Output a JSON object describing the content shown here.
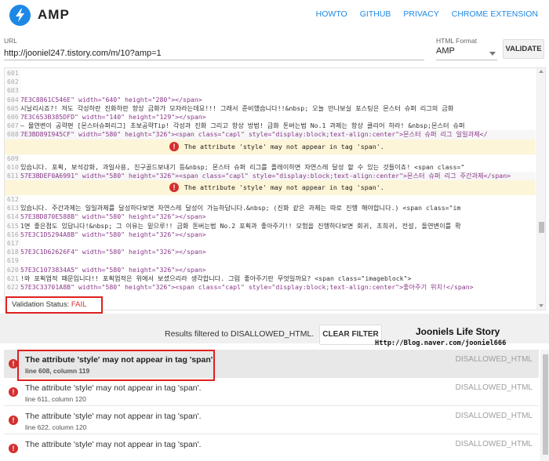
{
  "header": {
    "brand": "AMP",
    "nav": [
      "HOWTO",
      "GITHUB",
      "PRIVACY",
      "CHROME EXTENSION"
    ]
  },
  "url_field": {
    "label": "URL",
    "value": "http://jooniel247.tistory.com/m/10?amp=1"
  },
  "format_select": {
    "label": "HTML Format",
    "value": "AMP"
  },
  "validate_label": "VALIDATE",
  "editor": {
    "lines": [
      {
        "num": "601",
        "code": ""
      },
      {
        "num": "602",
        "code": ""
      },
      {
        "num": "603",
        "code": ""
      },
      {
        "num": "604",
        "code": "7E3C8861C546E\" width=\"640\" height=\"280\"></span>"
      },
      {
        "num": "605",
        "code": "시닐리시죠?! 저도 각성하란 진화하란 항상 금화가 모자라는데요!!! 그래서 준비했습니다!!&nbsp; 오늘 만나보실 포스팅은 몬스터 슈퍼 리그의 금화"
      },
      {
        "num": "606",
        "code": "7E3C653B385DFD\" width=\"140\" height=\"129\"></span>"
      },
      {
        "num": "607",
        "code": "– 몰연변이 공략편 [몬스터슈퍼리그] 초보공략Tip! 각성과 진화 그리고 항상 방법! 금화 돈버는법 No.1 과제는 항상 클리어 하라! &nbsp;몬스터 슈퍼"
      },
      {
        "num": "608",
        "code": "7E3BD89I945CF\" width=\"580\" height=\"326\"><span class=\"capl\" style=\"display:block;text-align:center\">몬스터 슈퍼 리그 일일과제</"
      }
    ],
    "error1": "The attribute 'style' may not appear in tag 'span'.",
    "lines2": [
      {
        "num": "609",
        "code": ""
      },
      {
        "num": "610",
        "code": "있습니다. 포획, 보석강화, 과일사용, 친구골드보내기 등&nbsp; 몬스터 슈퍼 리그를 플레이하면 자연스레 달성 할 수 있는 것들이죠! <span class=\""
      },
      {
        "num": "611",
        "code": "57E3BDEF0A6991\" width=\"580\" height=\"326\"><span class=\"capl\" style=\"display:block;text-align:center\">몬스터 슈퍼 리그 주간과제</span>"
      }
    ],
    "error2": "The attribute 'style' may not appear in tag 'span'.",
    "lines3": [
      {
        "num": "612",
        "code": ""
      },
      {
        "num": "613",
        "code": "있습니다. 주간과제는 일일과제를 달성하다보면 자연스레 달성이 가능하답니다.&nbsp; (진화 같은 과제는 따로 진행 해야합니다.) <span class=\"im"
      },
      {
        "num": "614",
        "code": "57E3BD870E588B\" width=\"580\" height=\"326\"></span>"
      },
      {
        "num": "615",
        "code": "1면 좋은점도 있답니다!&nbsp; 그 이유는 밑으루!! 금화 돈버는법 No.2 포획과 좋아주기!! 모험을 진행하다보면 회귀, 초희귀, 전설, 돌연변이를 확"
      },
      {
        "num": "616",
        "code": "57E3C1D5294A8B\" width=\"580\" height=\"326\"></span>"
      },
      {
        "num": "617",
        "code": ""
      },
      {
        "num": "618",
        "code": "57E3C1D62626F4\" width=\"580\" height=\"326\"></span>"
      },
      {
        "num": "619",
        "code": ""
      },
      {
        "num": "620",
        "code": "57E3C1073834A5\" width=\"580\" height=\"326\"></span>"
      },
      {
        "num": "621",
        "code": "!와 포획업적 때문입니다!! 포획업적은 위에서 보셨으리라 생각합니다. 그럼 좋아주기란 무엇일까요? <span class=\"imageblock\">"
      },
      {
        "num": "622",
        "code": "57E3C33701A8B\" width=\"580\" height=\"326\"><span class=\"capl\" style=\"display:block;text-align:center\">좋아주기 위치!</span>"
      }
    ]
  },
  "validation": {
    "label": "Validation Status:",
    "status": "FAIL"
  },
  "filter": {
    "text": "Results filtered to DISALLOWED_HTML.",
    "clear_label": "CLEAR FILTER"
  },
  "watermark": {
    "title": "Jooniels Life Story",
    "url": "Http://Blog.naver.com/jooniel666"
  },
  "results": [
    {
      "message": "The attribute 'style' may not appear in tag 'span'.",
      "location": "line 608, column 119",
      "category": "DISALLOWED_HTML"
    },
    {
      "message": "The attribute 'style' may not appear in tag 'span'.",
      "location": "line 611, column 120",
      "category": "DISALLOWED_HTML"
    },
    {
      "message": "The attribute 'style' may not appear in tag 'span'.",
      "location": "line 622, column 120",
      "category": "DISALLOWED_HTML"
    },
    {
      "message": "The attribute 'style' may not appear in tag 'span'.",
      "location": "",
      "category": "DISALLOWED_HTML"
    }
  ],
  "colors": {
    "accent": "#1e88e5",
    "error": "#d32f2f",
    "warning_bg": "#fdf5d7"
  }
}
